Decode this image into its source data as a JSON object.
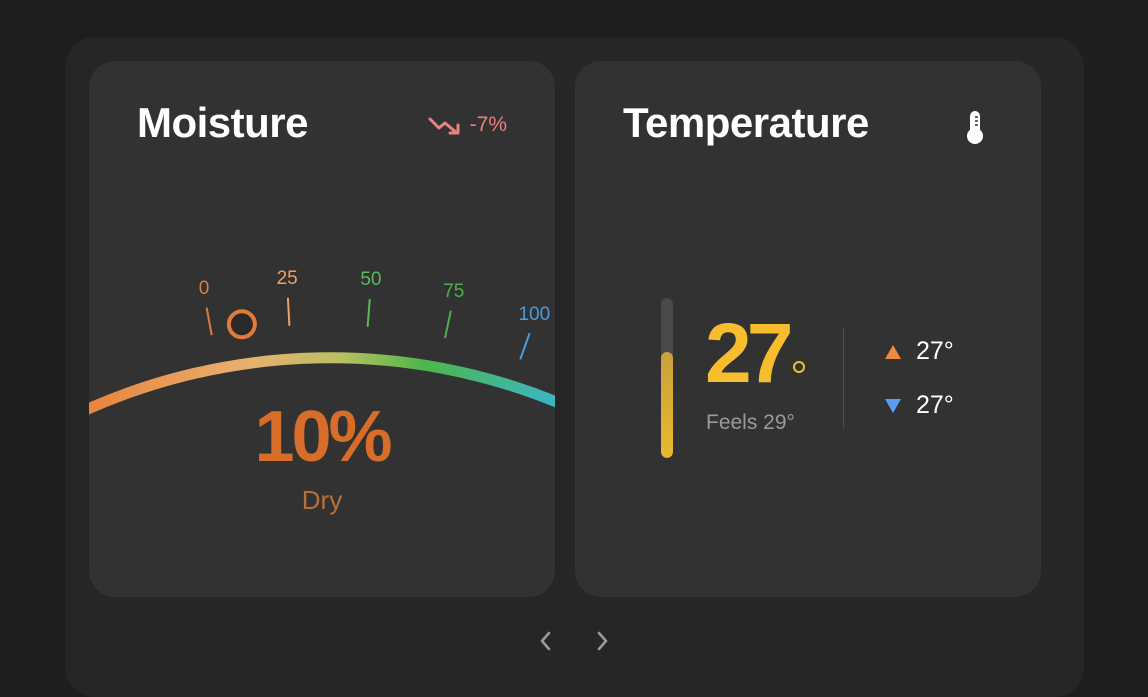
{
  "moisture": {
    "title": "Moisture",
    "trend": "-7%",
    "trend_color": "#e8827a",
    "ticks": [
      {
        "label": "0",
        "value": 0,
        "color": "#e07b3a"
      },
      {
        "label": "25",
        "value": 25,
        "color": "#f0a060"
      },
      {
        "label": "50",
        "value": 50,
        "color": "#5cb85c"
      },
      {
        "label": "75",
        "value": 75,
        "color": "#4caf50"
      },
      {
        "label": "100",
        "value": 100,
        "color": "#4a9be0"
      }
    ],
    "level": 10,
    "value": "10%",
    "status": "Dry",
    "value_color": "#d86d2a"
  },
  "temperature": {
    "title": "Temperature",
    "icon": "thermometer-icon",
    "value": "27",
    "level": 0.66,
    "feels": "Feels 29°",
    "high": "27°",
    "low": "27°",
    "value_color": "#f6bd2d"
  },
  "navigation": {
    "prev_icon": "chevron-left-icon",
    "next_icon": "chevron-right-icon"
  }
}
